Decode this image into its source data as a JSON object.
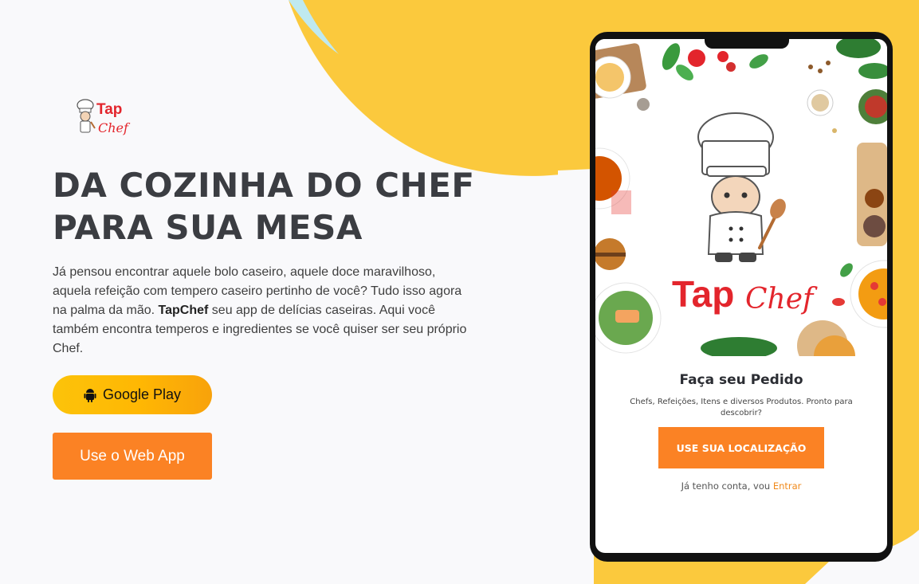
{
  "brand": {
    "logo_text_top": "Tap",
    "logo_text_bottom": "Chef",
    "colors": {
      "yellow": "#fbc93d",
      "orange": "#fb8224",
      "red": "#e3252c",
      "dark": "#3b3d42"
    }
  },
  "hero": {
    "headline_line1": "DA COZINHA DO CHEF",
    "headline_line2": "PARA SUA MESA",
    "intro_part1": "Já pensou encontrar aquele bolo caseiro, aquele doce maravilhoso, aquela refeição com tempero caseiro pertinho de você? Tudo isso agora na palma da mão. ",
    "intro_bold": "TapChef",
    "intro_part2": " seu app de delícias caseiras. Aqui você também encontra temperos e ingredientes se você quiser ser seu próprio Chef."
  },
  "buttons": {
    "google_play_label": "Google Play",
    "google_play_icon": "android-icon",
    "web_app_label": "Use o Web App"
  },
  "phone": {
    "app_logo_tap": "Tap",
    "app_logo_chef": "Chef",
    "order_title": "Faça seu Pedido",
    "order_subtitle": "Chefs, Refeições, Itens e diversos Produtos. Pronto para descobrir?",
    "location_button": "USE SUA LOCALIZAÇÃO",
    "login_prefix": "Já tenho conta, vou ",
    "login_link": "Entrar"
  }
}
